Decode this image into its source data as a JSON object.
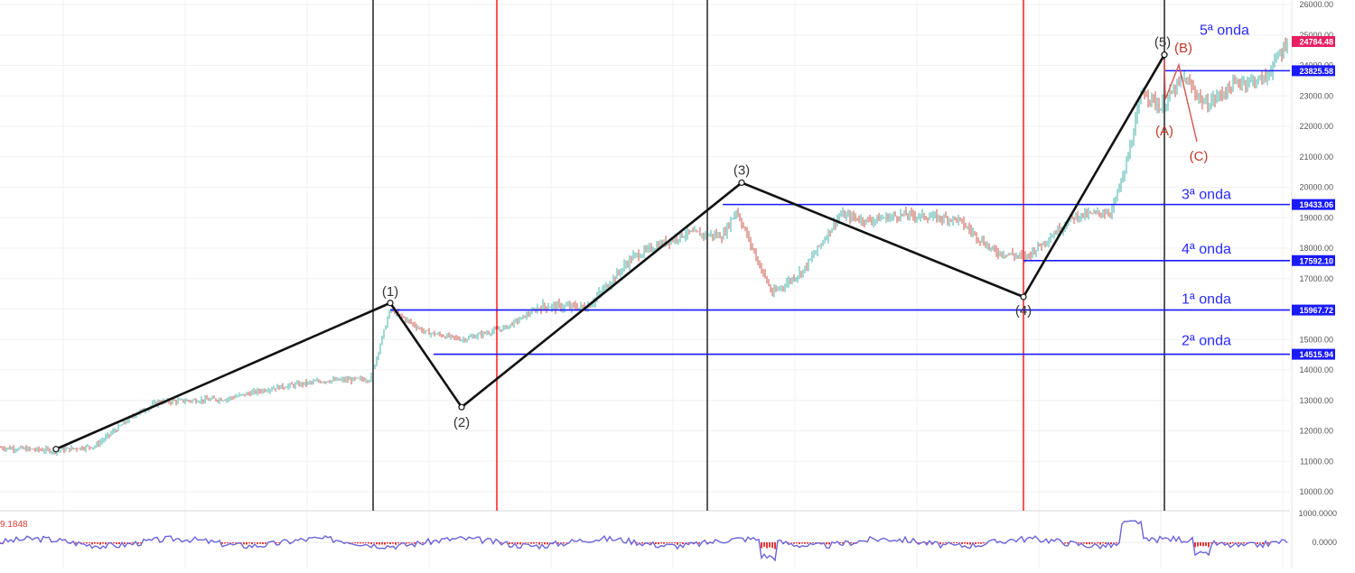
{
  "chart_data": {
    "type": "line",
    "title": "",
    "xlabel": "",
    "ylabel": "",
    "ylim": [
      9500,
      26300
    ],
    "grid": true,
    "colors": {
      "background": "#ffffff",
      "grid": "#eef0f3",
      "wave": "#111111",
      "level_line": "#1a1aff",
      "level_label_bg": "#1a1aff",
      "last_price_bg": "#e91e63",
      "wave_text": "#2b2bff",
      "corrective_text": "#c0392b",
      "candle_up": "#26a69a",
      "candle_down": "#c0392b",
      "vline_black": "#222222",
      "vline_red": "#ff1a1a",
      "osc_line": "#6b63d8",
      "osc_hist": "#e53935"
    },
    "y_ticks": [
      "26000.00",
      "25000.00",
      "24000.00",
      "23000.00",
      "22000.00",
      "21000.00",
      "20000.00",
      "19000.00",
      "18000.00",
      "17000.00",
      "16000.00",
      "15000.00",
      "14000.00",
      "13000.00",
      "12000.00",
      "11000.00",
      "10000.00"
    ],
    "y_tick_values": [
      26000,
      25000,
      24000,
      23000,
      22000,
      21000,
      20000,
      19000,
      18000,
      17000,
      16000,
      15000,
      14000,
      13000,
      12000,
      11000,
      10000
    ],
    "price_badges": [
      {
        "label": "24784.48",
        "value": 24784.48,
        "style": "last"
      },
      {
        "label": "23825.58",
        "value": 23825.58,
        "style": "level"
      },
      {
        "label": "19433.06",
        "value": 19433.06,
        "style": "level"
      },
      {
        "label": "17592.10",
        "value": 17592.1,
        "style": "level"
      },
      {
        "label": "15967.72",
        "value": 15967.72,
        "style": "level"
      },
      {
        "label": "14515.94",
        "value": 14515.94,
        "style": "level"
      }
    ],
    "horizontal_levels": [
      {
        "name": "5ª onda",
        "value": 23825.58
      },
      {
        "name": "3ª onda",
        "value": 19433.06
      },
      {
        "name": "4ª onda",
        "value": 17592.1
      },
      {
        "name": "1ª onda",
        "value": 15967.72
      },
      {
        "name": "2ª onda",
        "value": 14515.94
      }
    ],
    "wave_points": [
      {
        "label": "",
        "value": 11400
      },
      {
        "label": "(1)",
        "value": 16200
      },
      {
        "label": "(2)",
        "value": 12780
      },
      {
        "label": "(3)",
        "value": 20150
      },
      {
        "label": "(4)",
        "value": 16400
      },
      {
        "label": "(5)",
        "value": 24350
      }
    ],
    "corrective_labels": [
      "(A)",
      "(B)",
      "(C)"
    ],
    "oscillator": {
      "value_label": "9.1848",
      "ticks": [
        "1000.0000",
        "0.0000"
      ],
      "tick_values": [
        1000,
        0
      ]
    }
  }
}
